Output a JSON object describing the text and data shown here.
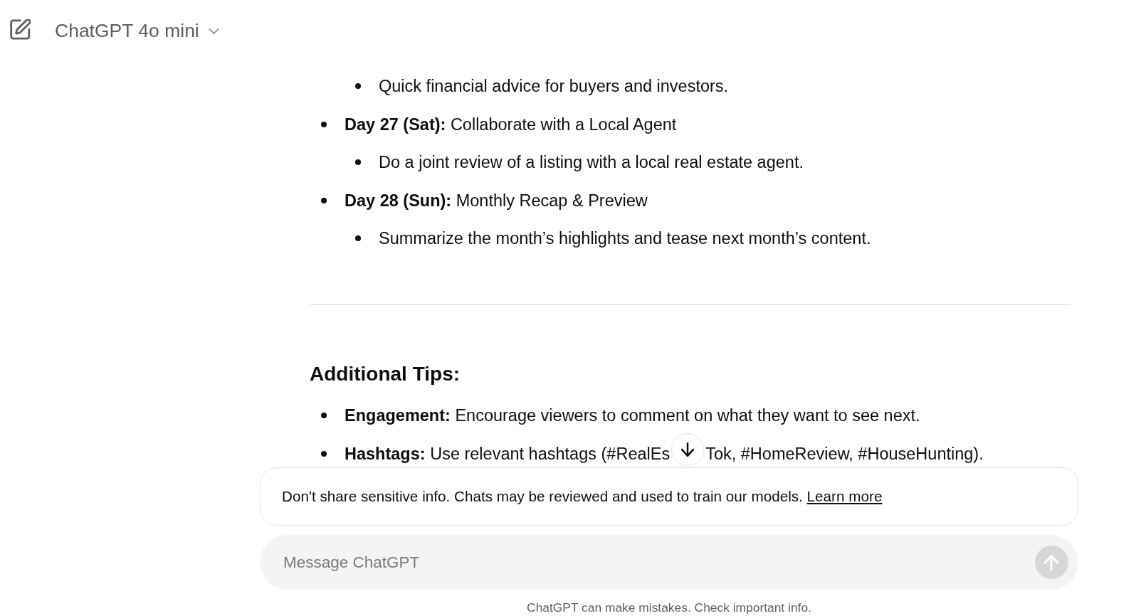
{
  "header": {
    "title": "ChatGPT 4o mini"
  },
  "conversation": {
    "blocks": [
      {
        "kind": "list",
        "items": [
          {
            "children": [
              {
                "text": "Quick financial advice for buyers and investors."
              }
            ]
          },
          {
            "text": "**Day 27 (Sat):** Collaborate with a Local Agent",
            "children": [
              {
                "text": "Do a joint review of a listing with a local real estate agent."
              }
            ]
          },
          {
            "text": "**Day 28 (Sun):** Monthly Recap & Preview",
            "children": [
              {
                "text": "Summarize the month’s highlights and tease next month’s content."
              }
            ]
          }
        ]
      },
      {
        "kind": "divider"
      },
      {
        "kind": "heading",
        "text": "Additional Tips:"
      },
      {
        "kind": "list",
        "items": [
          {
            "text": "**Engagement:** Encourage viewers to comment on what they want to see next."
          },
          {
            "segments": [
              "**Hashtags:** Use relevant hashtags (#RealEs",
              "Tok, #HomeReview, #HouseHunting)."
            ]
          }
        ]
      }
    ]
  },
  "notice": {
    "text": "Don't share sensitive info. Chats may be reviewed and used to train our models.",
    "link": "Learn more"
  },
  "composer": {
    "placeholder": "Message ChatGPT",
    "send_disabled": true
  },
  "footer": {
    "text": "ChatGPT can make mistakes. Check important info."
  }
}
